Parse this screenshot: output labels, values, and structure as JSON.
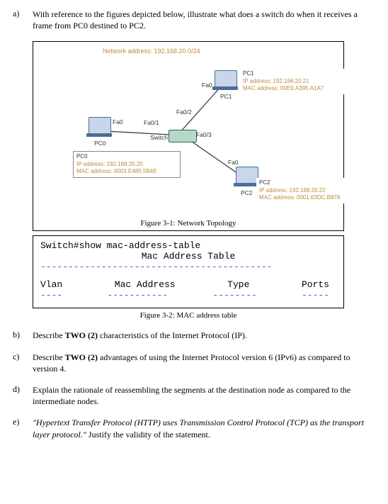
{
  "questions": {
    "a": {
      "label": "a)",
      "text_before": "With reference to the figures depicted below, illustrate what does a switch do when it receives a frame from PC0 destined to PC2."
    },
    "b": {
      "label": "b)",
      "text": "Describe TWO (2) characteristics of the Internet Protocol (IP)."
    },
    "c": {
      "label": "c)",
      "text": "Describe TWO (2) advantages of using the Internet Protocol version 6 (IPv6) as compared to version 4."
    },
    "d": {
      "label": "d)",
      "text": "Explain the rationale of reassembling the segments at the destination node as compared to the intermediate nodes."
    },
    "e": {
      "label": "e)",
      "quote": "\"Hypertext Transfer Protocol (HTTP) uses Transmission Control Protocol (TCP) as the transport layer protocol.\"",
      "tail": " Justify the validity of the statement."
    }
  },
  "figure1": {
    "caption": "Figure 3-1: Network Topology",
    "network_address": "Network address: 192.168.20.0/24",
    "pc0": {
      "name": "PC0",
      "fa": "Fa0",
      "info_title": "PC0",
      "ip": "IP address: 192.168.20.20",
      "mac": "MAC address: 0003.E480.5B4E"
    },
    "pc1": {
      "name": "PC1",
      "fa": "Fa0",
      "info_title": "PC1",
      "ip": "IP address: 192.168.20.21",
      "mac": "MAC address: 00E0.A395.A1A7"
    },
    "pc2": {
      "name": "PC2",
      "fa": "Fa0",
      "info_title": "PC2",
      "ip": "IP address: 192.168.20.22",
      "mac": "MAC address: 0001.63DC.B878"
    },
    "switch": {
      "name": "Switch",
      "ports": {
        "p1": "Fa0/1",
        "p2": "Fa0/2",
        "p3": "Fa0/3"
      }
    }
  },
  "figure2": {
    "caption": "Figure 3-2: MAC address table",
    "cmd": "Switch#show mac-address-table",
    "title": "Mac Address Table",
    "cols": {
      "c1": "Vlan",
      "c2": "Mac Address",
      "c3": "Type",
      "c4": "Ports"
    },
    "dashline": "------------------------------------------",
    "dashes": {
      "d1": "----",
      "d2": "-----------",
      "d3": "--------",
      "d4": "-----"
    }
  }
}
